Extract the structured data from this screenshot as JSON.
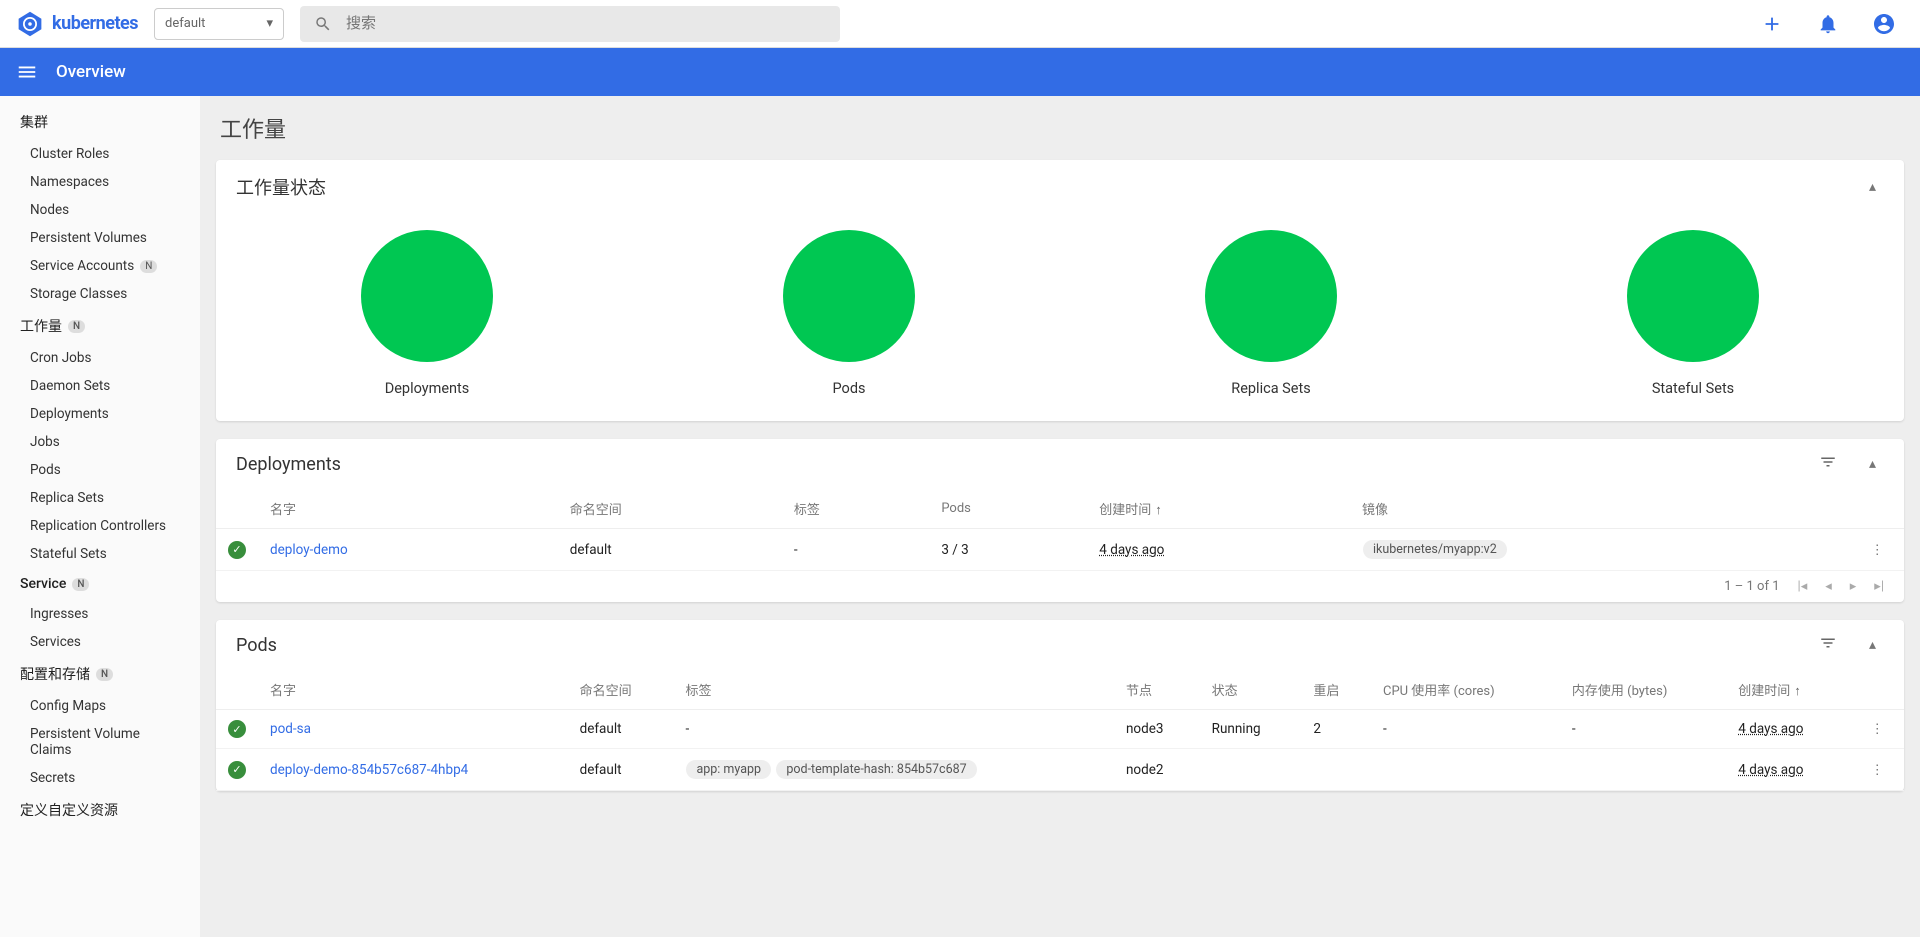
{
  "header": {
    "brand": "kubernetes",
    "namespace_selected": "default",
    "search_placeholder": "搜索"
  },
  "bluebar": {
    "title": "Overview"
  },
  "sidebar": {
    "sections": [
      {
        "title": "集群",
        "badge": null,
        "items": [
          {
            "label": "Cluster Roles",
            "badge": null
          },
          {
            "label": "Namespaces",
            "badge": null
          },
          {
            "label": "Nodes",
            "badge": null
          },
          {
            "label": "Persistent Volumes",
            "badge": null
          },
          {
            "label": "Service Accounts",
            "badge": "N"
          },
          {
            "label": "Storage Classes",
            "badge": null
          }
        ]
      },
      {
        "title": "工作量",
        "badge": "N",
        "items": [
          {
            "label": "Cron Jobs",
            "badge": null
          },
          {
            "label": "Daemon Sets",
            "badge": null
          },
          {
            "label": "Deployments",
            "badge": null
          },
          {
            "label": "Jobs",
            "badge": null
          },
          {
            "label": "Pods",
            "badge": null
          },
          {
            "label": "Replica Sets",
            "badge": null
          },
          {
            "label": "Replication Controllers",
            "badge": null
          },
          {
            "label": "Stateful Sets",
            "badge": null
          }
        ]
      },
      {
        "title": "Service",
        "badge": "N",
        "items": [
          {
            "label": "Ingresses",
            "badge": null
          },
          {
            "label": "Services",
            "badge": null
          }
        ]
      },
      {
        "title": "配置和存储",
        "badge": "N",
        "items": [
          {
            "label": "Config Maps",
            "badge": null
          },
          {
            "label": "Persistent Volume Claims",
            "badge": null
          },
          {
            "label": "Secrets",
            "badge": null
          }
        ]
      },
      {
        "title": "定义自定义资源",
        "badge": null,
        "items": []
      }
    ]
  },
  "page": {
    "title": "工作量"
  },
  "status_card": {
    "title": "工作量状态",
    "items": [
      {
        "label": "Deployments"
      },
      {
        "label": "Pods"
      },
      {
        "label": "Replica Sets"
      },
      {
        "label": "Stateful Sets"
      }
    ]
  },
  "deployments": {
    "title": "Deployments",
    "columns": {
      "name": "名字",
      "namespace": "命名空间",
      "labels": "标签",
      "pods": "Pods",
      "created": "创建时间",
      "images": "镜像"
    },
    "rows": [
      {
        "name": "deploy-demo",
        "namespace": "default",
        "labels": "-",
        "pods": "3 / 3",
        "created": "4 days ago",
        "image": "ikubernetes/myapp:v2"
      }
    ],
    "pagination": "1 – 1 of 1"
  },
  "pods": {
    "title": "Pods",
    "columns": {
      "name": "名字",
      "namespace": "命名空间",
      "labels": "标签",
      "node": "节点",
      "status": "状态",
      "restarts": "重启",
      "cpu": "CPU 使用率 (cores)",
      "memory": "内存使用 (bytes)",
      "created": "创建时间"
    },
    "rows": [
      {
        "name": "pod-sa",
        "namespace": "default",
        "labels": [
          "-"
        ],
        "node": "node3",
        "status": "Running",
        "restarts": "2",
        "cpu": "-",
        "memory": "-",
        "created": "4 days ago"
      },
      {
        "name": "deploy-demo-854b57c687-4hbp4",
        "namespace": "default",
        "labels": [
          "app: myapp",
          "pod-template-hash: 854b57c687"
        ],
        "node": "node2",
        "status": "",
        "restarts": "",
        "cpu": "",
        "memory": "",
        "created": "4 days ago"
      }
    ]
  }
}
